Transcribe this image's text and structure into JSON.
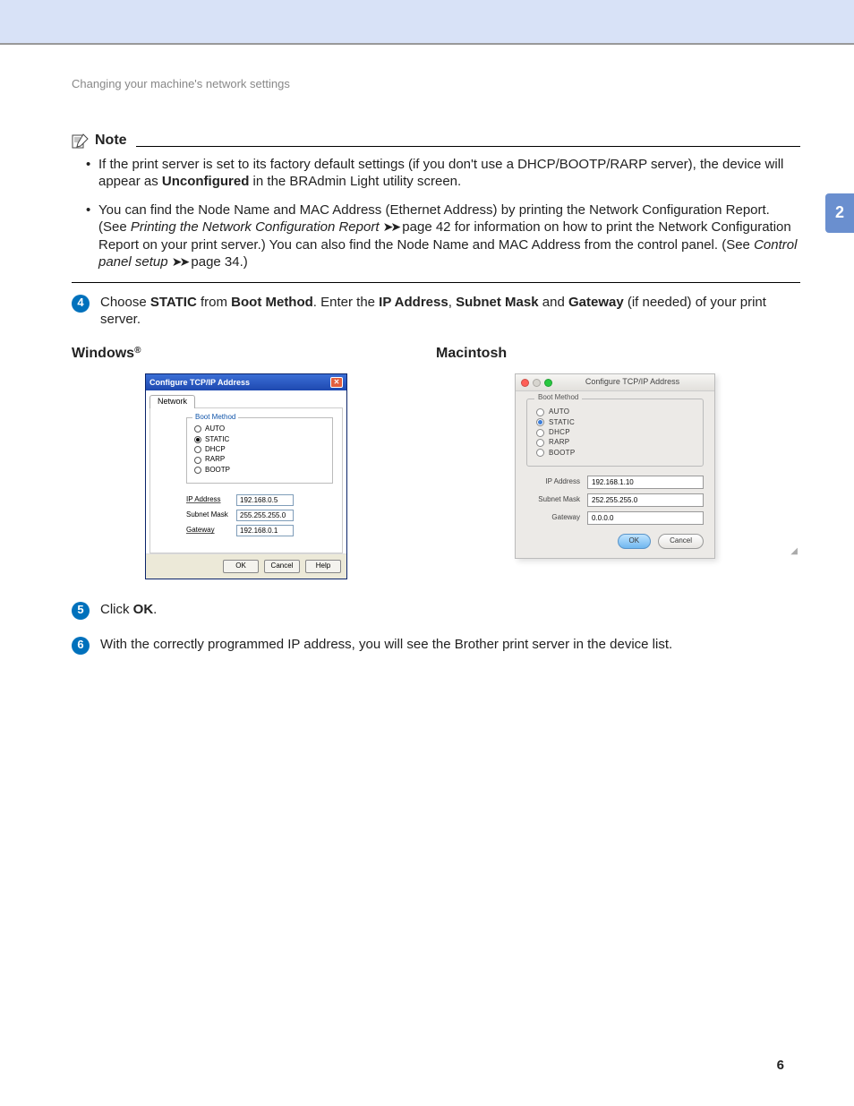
{
  "header": "Changing your machine's network settings",
  "side_tab": "2",
  "page_number": "6",
  "note": {
    "title": "Note",
    "bullets": [
      {
        "pre": "If the print server is set to its factory default settings (if you don't use a DHCP/BOOTP/RARP server), the device will appear as ",
        "bold1": "Unconfigured",
        "post1": " in the BRAdmin Light utility screen."
      },
      {
        "pre": "You can find the Node Name and MAC Address (Ethernet Address) by printing the Network Configuration Report. (See ",
        "ref1": "Printing the Network Configuration Report",
        "mid1": " page 42 for information on how to print the Network Configuration Report on your print server.) You can also find the Node Name and MAC Address from the control panel. (See ",
        "ref2": "Control panel setup",
        "mid2": " page 34.)"
      }
    ]
  },
  "steps": {
    "s4": {
      "num": "4",
      "t1": "Choose ",
      "b1": "STATIC",
      "t2": " from ",
      "b2": "Boot Method",
      "t3": ". Enter the ",
      "b3": "IP Address",
      "t4": ", ",
      "b4": "Subnet Mask",
      "t5": " and ",
      "b5": "Gateway",
      "t6": " (if needed) of your print server."
    },
    "s5": {
      "num": "5",
      "t1": "Click ",
      "b1": "OK",
      "t2": "."
    },
    "s6": {
      "num": "6",
      "t1": "With the correctly programmed IP address, you will see the Brother print server in the device list."
    }
  },
  "os": {
    "win": "Windows",
    "reg": "®",
    "mac": "Macintosh"
  },
  "win_dialog": {
    "title": "Configure TCP/IP Address",
    "tab": "Network",
    "legend": "Boot Method",
    "radios": [
      "AUTO",
      "STATIC",
      "DHCP",
      "RARP",
      "BOOTP"
    ],
    "selected": "STATIC",
    "ip_label": "IP Address",
    "ip": "192.168.0.5",
    "mask_label": "Subnet Mask",
    "mask": "255.255.255.0",
    "gw_label": "Gateway",
    "gw": "192.168.0.1",
    "buttons": {
      "ok": "OK",
      "cancel": "Cancel",
      "help": "Help"
    }
  },
  "mac_dialog": {
    "title": "Configure TCP/IP Address",
    "legend": "Boot Method",
    "radios": [
      "AUTO",
      "STATIC",
      "DHCP",
      "RARP",
      "BOOTP"
    ],
    "selected": "STATIC",
    "ip_label": "IP Address",
    "ip": "192.168.1.10",
    "mask_label": "Subnet Mask",
    "mask": "252.255.255.0",
    "gw_label": "Gateway",
    "gw": "0.0.0.0",
    "buttons": {
      "ok": "OK",
      "cancel": "Cancel"
    }
  }
}
